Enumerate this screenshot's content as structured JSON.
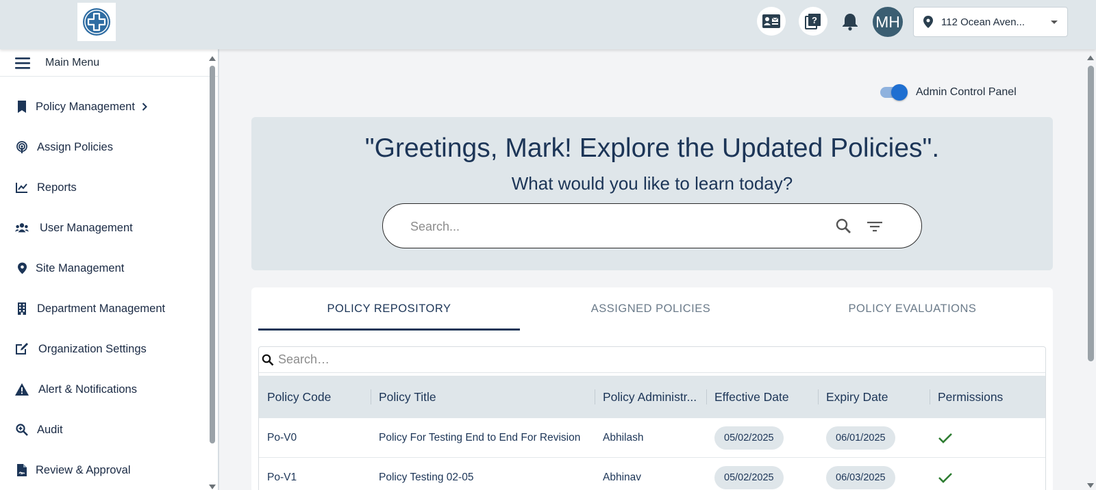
{
  "header": {
    "avatar_initials": "MH",
    "location": "112 Ocean Aven..."
  },
  "sidebar": {
    "menu_title": "Main Menu",
    "items": [
      {
        "label": "Policy Management",
        "icon": "bookmark-icon"
      },
      {
        "label": "Assign Policies",
        "icon": "podcast-icon"
      },
      {
        "label": "Reports",
        "icon": "chart-line-icon"
      },
      {
        "label": "User Management",
        "icon": "users-icon"
      },
      {
        "label": "Site Management",
        "icon": "location-pin-icon"
      },
      {
        "label": "Department Management",
        "icon": "building-icon"
      },
      {
        "label": "Organization Settings",
        "icon": "edit-icon"
      },
      {
        "label": "Alert & Notifications",
        "icon": "warning-icon"
      },
      {
        "label": "Audit",
        "icon": "zoom-in-icon"
      },
      {
        "label": "Review & Approval",
        "icon": "file-signature-icon"
      }
    ]
  },
  "admin_toggle": {
    "label": "Admin Control Panel",
    "on": true
  },
  "hero": {
    "greeting": "\"Greetings, Mark! Explore the Updated Policies\".",
    "subtitle": "What would you like to learn today?",
    "search_placeholder": "Search..."
  },
  "tabs": [
    {
      "label": "POLICY REPOSITORY",
      "active": true
    },
    {
      "label": "ASSIGNED POLICIES",
      "active": false
    },
    {
      "label": "POLICY EVALUATIONS",
      "active": false
    }
  ],
  "table": {
    "search_placeholder": "Search…",
    "columns": [
      "Policy Code",
      "Policy Title",
      "Policy Administr...",
      "Effective Date",
      "Expiry Date",
      "Permissions"
    ],
    "rows": [
      {
        "code": "Po-V0",
        "title": "Policy For Testing End to End For Revision",
        "admin": "Abhilash",
        "effective": "05/02/2025",
        "expiry": "06/01/2025",
        "permission": "check"
      },
      {
        "code": "Po-V1",
        "title": "Policy Testing 02-05",
        "admin": "Abhinav",
        "effective": "05/02/2025",
        "expiry": "06/03/2025",
        "permission": "check"
      }
    ]
  },
  "colors": {
    "primary_navy": "#1c3557",
    "header_bg": "#dfe6ea",
    "toggle_blue": "#1f6fd1",
    "check_green": "#2e7d32"
  }
}
